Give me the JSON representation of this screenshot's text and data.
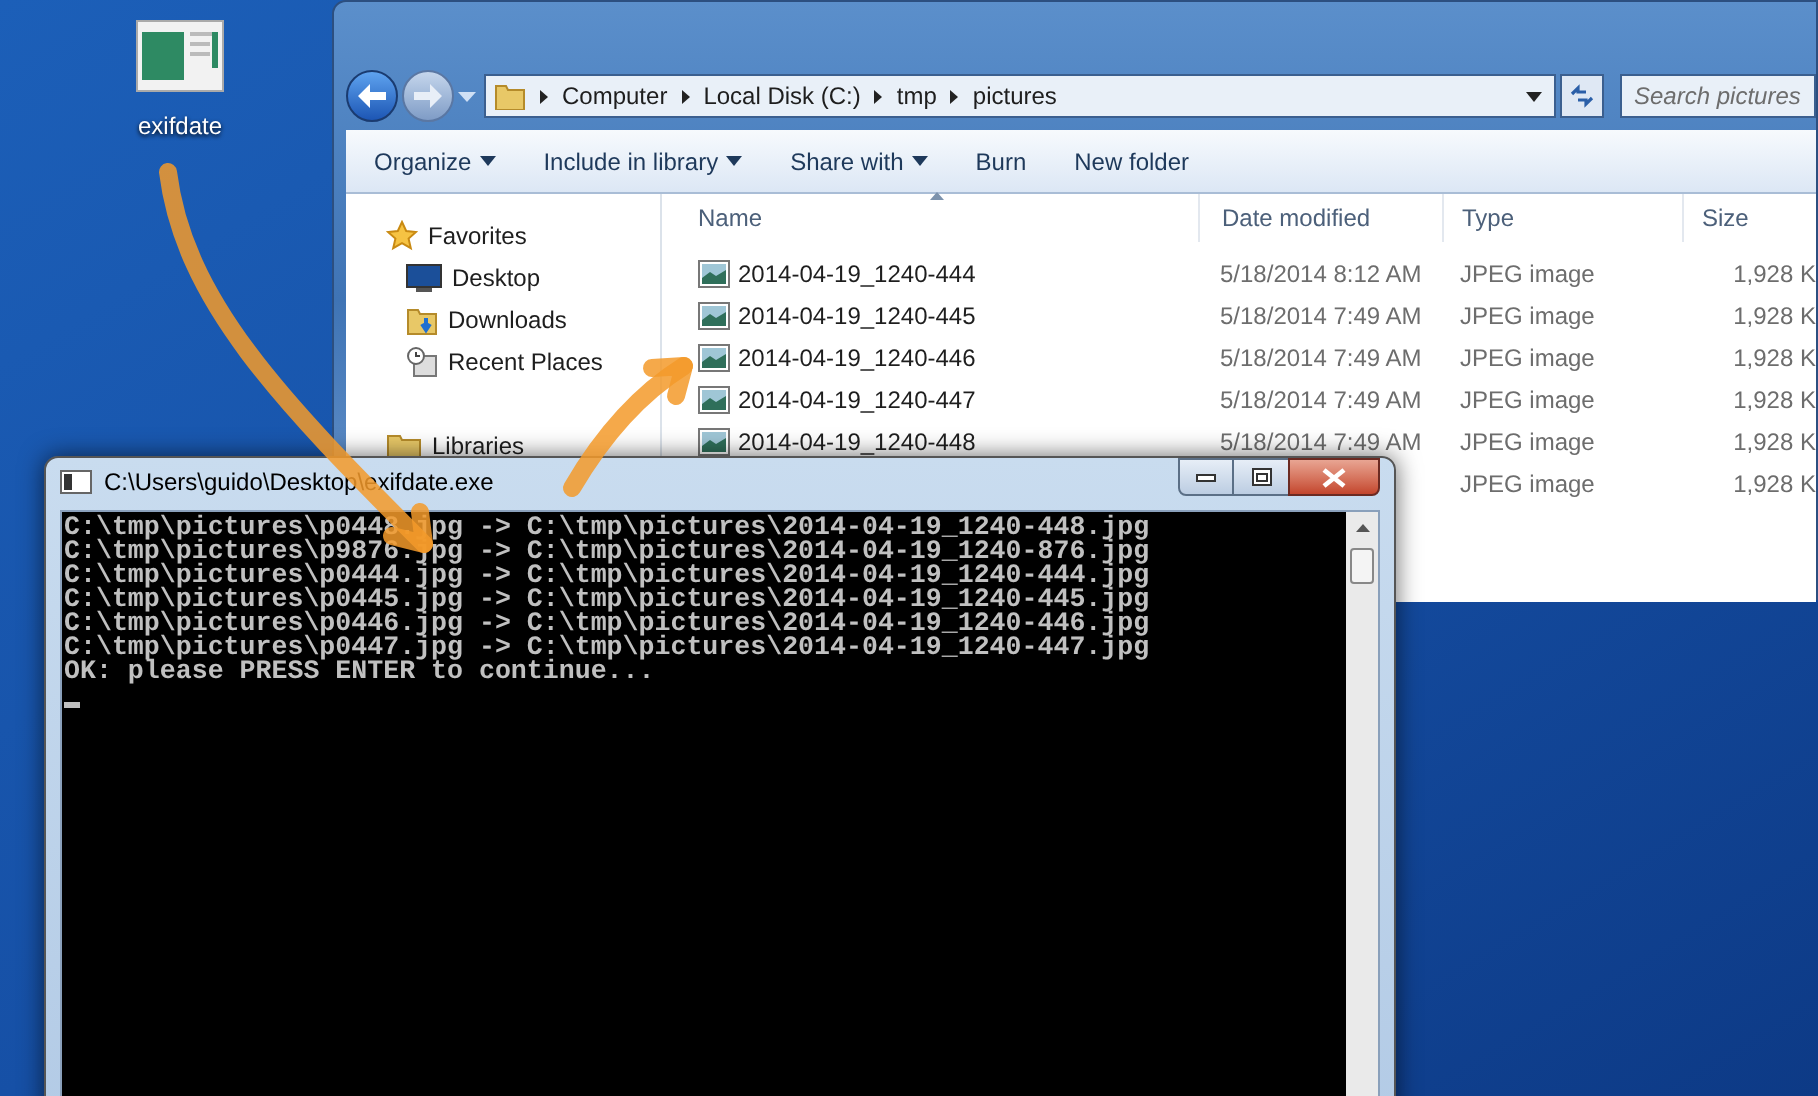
{
  "desktop_icon": {
    "label": "exifdate"
  },
  "explorer": {
    "breadcrumbs": [
      "Computer",
      "Local Disk (C:)",
      "tmp",
      "pictures"
    ],
    "search": {
      "placeholder": "Search pictures"
    },
    "toolbar": [
      {
        "label": "Organize",
        "dropdown": true
      },
      {
        "label": "Include in library",
        "dropdown": true
      },
      {
        "label": "Share with",
        "dropdown": true
      },
      {
        "label": "Burn",
        "dropdown": false
      },
      {
        "label": "New folder",
        "dropdown": false
      }
    ],
    "nav": [
      {
        "label": "Favorites",
        "kind": "favorites"
      },
      {
        "label": "Desktop",
        "kind": "desktop"
      },
      {
        "label": "Downloads",
        "kind": "downloads"
      },
      {
        "label": "Recent Places",
        "kind": "recent"
      },
      {
        "label": "Libraries",
        "kind": "libraries"
      }
    ],
    "columns": [
      {
        "label": "Name",
        "sorted": true
      },
      {
        "label": "Date modified",
        "sorted": false
      },
      {
        "label": "Type",
        "sorted": false
      },
      {
        "label": "Size",
        "sorted": false
      }
    ],
    "rows": [
      {
        "name": "2014-04-19_1240-444",
        "date": "5/18/2014 8:12 AM",
        "type": "JPEG image",
        "size": "1,928 K"
      },
      {
        "name": "2014-04-19_1240-445",
        "date": "5/18/2014 7:49 AM",
        "type": "JPEG image",
        "size": "1,928 K"
      },
      {
        "name": "2014-04-19_1240-446",
        "date": "5/18/2014 7:49 AM",
        "type": "JPEG image",
        "size": "1,928 K"
      },
      {
        "name": "2014-04-19_1240-447",
        "date": "5/18/2014 7:49 AM",
        "type": "JPEG image",
        "size": "1,928 K"
      },
      {
        "name": "2014-04-19_1240-448",
        "date": "5/18/2014 7:49 AM",
        "type": "JPEG image",
        "size": "1,928 K"
      },
      {
        "type": "JPEG image",
        "size": "1,928 K"
      }
    ]
  },
  "console": {
    "title": "C:\\Users\\guido\\Desktop\\exifdate.exe",
    "lines": [
      "C:\\tmp\\pictures\\p0448.jpg -> C:\\tmp\\pictures\\2014-04-19_1240-448.jpg",
      "C:\\tmp\\pictures\\p9876.jpg -> C:\\tmp\\pictures\\2014-04-19_1240-876.jpg",
      "C:\\tmp\\pictures\\p0444.jpg -> C:\\tmp\\pictures\\2014-04-19_1240-444.jpg",
      "C:\\tmp\\pictures\\p0445.jpg -> C:\\tmp\\pictures\\2014-04-19_1240-445.jpg",
      "C:\\tmp\\pictures\\p0446.jpg -> C:\\tmp\\pictures\\2014-04-19_1240-446.jpg",
      "C:\\tmp\\pictures\\p0447.jpg -> C:\\tmp\\pictures\\2014-04-19_1240-447.jpg",
      "OK: please PRESS ENTER to continue..."
    ],
    "cursor": true
  }
}
